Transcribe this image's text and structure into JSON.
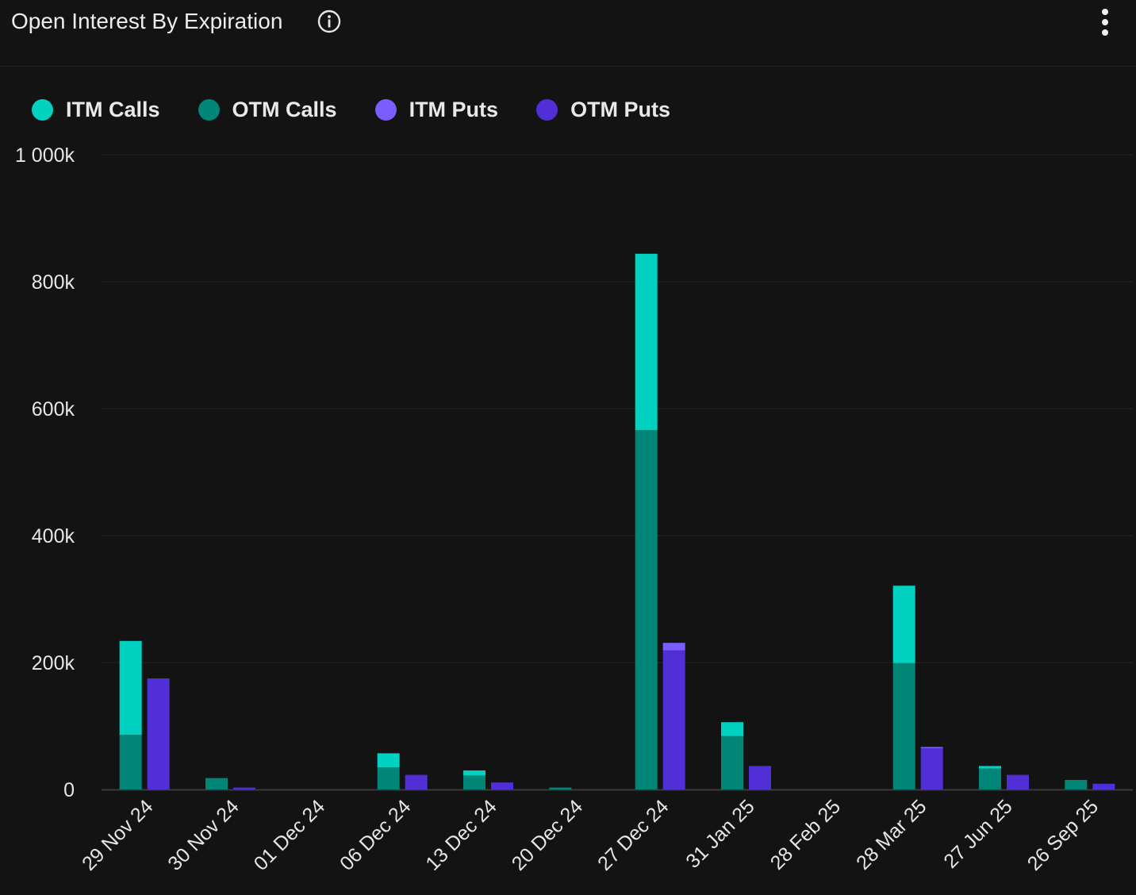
{
  "header": {
    "title": "Open Interest By Expiration",
    "info_icon": "info-icon",
    "menu_icon": "kebab-menu-icon"
  },
  "colors": {
    "background": "#131313",
    "itm_calls": "#00d1c1",
    "otm_calls": "#008577",
    "itm_puts": "#7a5cff",
    "otm_puts": "#5030d6",
    "grid": "#1e1e1e",
    "axis_text": "#e6e6e6"
  },
  "legend": [
    {
      "label": "ITM Calls",
      "color": "#00d1c1"
    },
    {
      "label": "OTM Calls",
      "color": "#008577"
    },
    {
      "label": "ITM Puts",
      "color": "#7a5cff"
    },
    {
      "label": "OTM Puts",
      "color": "#5030d6"
    }
  ],
  "chart_data": {
    "type": "bar",
    "stacked": true,
    "grouped": [
      "calls",
      "puts"
    ],
    "categories": [
      "29 Nov 24",
      "30 Nov 24",
      "01 Dec 24",
      "06 Dec 24",
      "13 Dec 24",
      "20 Dec 24",
      "27 Dec 24",
      "31 Jan 25",
      "28 Feb 25",
      "28 Mar 25",
      "27 Jun 25",
      "26 Sep 25"
    ],
    "series": [
      {
        "name": "ITM Calls",
        "group": "calls",
        "values": [
          148000,
          0,
          0,
          22000,
          8000,
          0,
          278000,
          22000,
          0,
          122000,
          4000,
          0
        ]
      },
      {
        "name": "OTM Calls",
        "group": "calls",
        "values": [
          86000,
          18000,
          0,
          35000,
          22000,
          3000,
          566000,
          84000,
          0,
          199000,
          33000,
          15000
        ]
      },
      {
        "name": "ITM Puts",
        "group": "puts",
        "values": [
          0,
          0,
          0,
          0,
          0,
          0,
          12000,
          0,
          0,
          2000,
          0,
          0
        ]
      },
      {
        "name": "OTM Puts",
        "group": "puts",
        "values": [
          175000,
          3000,
          0,
          23000,
          11000,
          0,
          219000,
          37000,
          0,
          65000,
          23000,
          9000
        ]
      }
    ],
    "y_ticks": [
      {
        "value": 0,
        "label": "0"
      },
      {
        "value": 200000,
        "label": "200k"
      },
      {
        "value": 400000,
        "label": "400k"
      },
      {
        "value": 600000,
        "label": "600k"
      },
      {
        "value": 800000,
        "label": "800k"
      },
      {
        "value": 1000000,
        "label": "1 000k"
      }
    ],
    "ylim": [
      0,
      1000000
    ],
    "grid": true,
    "legend_position": "top-left",
    "title": "Open Interest By Expiration",
    "xlabel": "",
    "ylabel": ""
  }
}
